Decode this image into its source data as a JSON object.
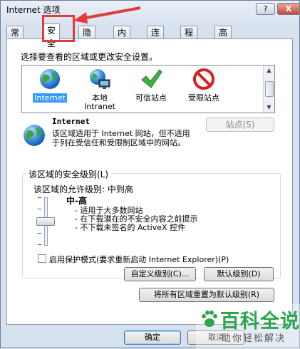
{
  "window": {
    "title": "Internet 选项",
    "help_label": "?",
    "close_label": "X"
  },
  "tabs": [
    {
      "label": "常规"
    },
    {
      "label": "安全"
    },
    {
      "label": "隐私"
    },
    {
      "label": "内容"
    },
    {
      "label": "连接"
    },
    {
      "label": "程序"
    },
    {
      "label": "高级"
    }
  ],
  "security": {
    "zone_prompt": "选择要查看的区域或更改安全设置。",
    "zones": [
      {
        "label": "Internet",
        "icon": "globe-icon"
      },
      {
        "label": "本地\nIntranet",
        "icon": "intranet-icon"
      },
      {
        "label": "可信站点",
        "icon": "checkmark-icon"
      },
      {
        "label": "受限站点",
        "icon": "restricted-icon"
      }
    ],
    "selected_zone_name": "Internet",
    "sites_button": "站点(S)",
    "zone_desc": "该区域适用于 Internet 网站，但不适用于列在受信任和受限制区域中的网站。",
    "level_group_title": "该区域的安全级别(L)",
    "allowed_levels": "该区域的允许级别: 中到高",
    "level_name": "中-高",
    "level_bullets": [
      "- 适用于大多数网站",
      "- 在下载潜在的不安全内容之前提示",
      "- 不下载未签名的 ActiveX 控件"
    ],
    "protected_mode_label": "启用保护模式(要求重新启动 Internet Explorer)(P)",
    "custom_level_button": "自定义级别(C)...",
    "default_level_button": "默认级别(D)",
    "reset_all_button": "将所有区域重置为默认级别(R)"
  },
  "footer": {
    "ok_button": "确定",
    "cancel_button": "取消"
  },
  "watermark": {
    "main": "百科全说",
    "sub": "助你轻松解决"
  },
  "colors": {
    "highlight": "#3399ff",
    "annotation_red": "#e33b3b",
    "watermark_green": "#2da44e"
  }
}
